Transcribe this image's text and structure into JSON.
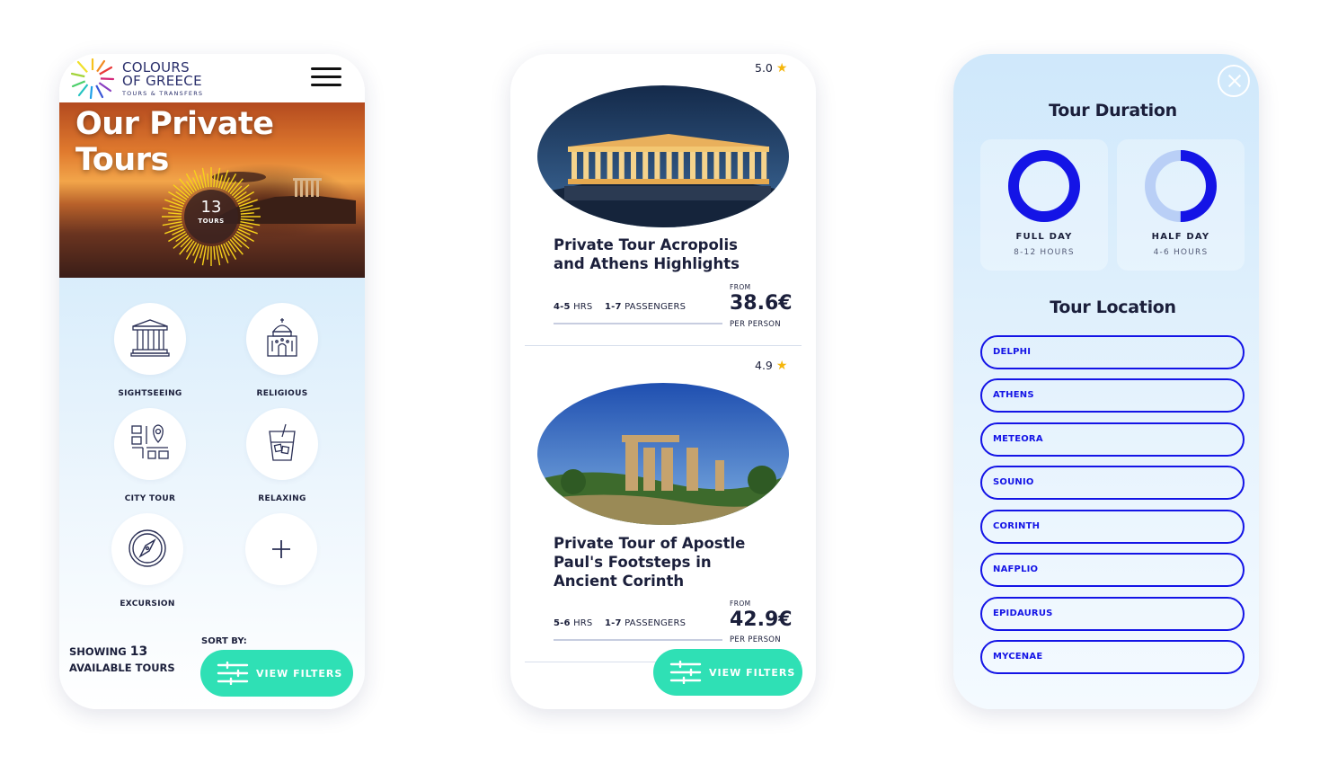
{
  "brand": {
    "name_line1": "COLOURS",
    "name_line2": "OF GREECE",
    "tagline": "TOURS & TRANSFERS"
  },
  "screen1": {
    "hero_title": "Our Private Tours",
    "tour_count": "13",
    "tour_count_label": "TOURS",
    "categories": [
      {
        "label": "SIGHTSEEING",
        "icon": "temple-icon"
      },
      {
        "label": "RELIGIOUS",
        "icon": "church-icon"
      },
      {
        "label": "CITY TOUR",
        "icon": "city-map-icon"
      },
      {
        "label": "RELAXING",
        "icon": "drink-icon"
      },
      {
        "label": "EXCURSION",
        "icon": "compass-icon"
      },
      {
        "label": "",
        "icon": "plus-icon"
      }
    ],
    "showing_prefix": "SHOWING",
    "showing_count": "13",
    "showing_suffix": "AVAILABLE TOURS",
    "sort_by": "SORT BY:",
    "filters_button": "VIEW FILTERS"
  },
  "screen2": {
    "tours": [
      {
        "rating": "5.0",
        "title": "Private Tour Acropolis and Athens Highlights",
        "duration_value": "4-5",
        "duration_unit": "HRS",
        "passengers_value": "1-7",
        "passengers_unit": "PASSENGERS",
        "from_label": "FROM",
        "price": "38.6€",
        "per_person": "PER PERSON"
      },
      {
        "rating": "4.9",
        "title": "Private Tour of Apostle Paul's Footsteps in Ancient Corinth",
        "duration_value": "5-6",
        "duration_unit": "HRS",
        "passengers_value": "1-7",
        "passengers_unit": "PASSENGERS",
        "from_label": "FROM",
        "price": "42.9€",
        "per_person": "PER PERSON"
      }
    ],
    "filters_button": "VIEW FILTERS"
  },
  "screen3": {
    "duration_title": "Tour Duration",
    "durations": [
      {
        "name": "FULL DAY",
        "hours": "8-12 HOURS",
        "fill_fraction": 1.0
      },
      {
        "name": "HALF DAY",
        "hours": "4-6 HOURS",
        "fill_fraction": 0.5
      }
    ],
    "location_title": "Tour Location",
    "locations": [
      "DELPHI",
      "ATHENS",
      "METEORA",
      "SOUNIO",
      "CORINTH",
      "NAFPLIO",
      "EPIDAURUS",
      "MYCENAE"
    ]
  },
  "colors": {
    "accent_blue": "#1414e6",
    "filter_button": "#2fe0b5",
    "star": "#f5b60c",
    "text_dark": "#1b1f3b"
  }
}
